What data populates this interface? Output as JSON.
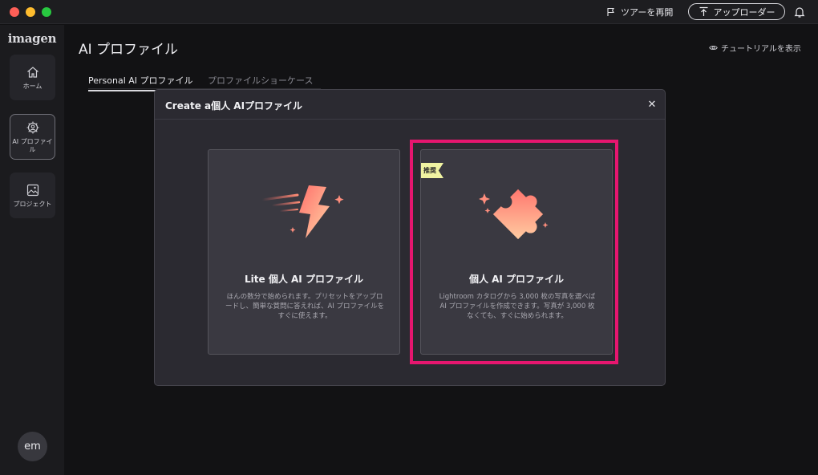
{
  "titlebar": {
    "tour_label": "ツアーを再開",
    "uploader_label": "アップローダー"
  },
  "sidebar": {
    "logo": "imagen",
    "items": [
      {
        "label": "ホーム",
        "icon": "home-icon"
      },
      {
        "label": "AI プロファイル",
        "icon": "ai-profile-icon"
      },
      {
        "label": "プロジェクト",
        "icon": "project-icon"
      }
    ],
    "avatar": "em"
  },
  "main": {
    "title": "AI プロファイル",
    "tutorial_link": "チュートリアルを表示",
    "tabs": [
      {
        "label": "Personal AI プロファイル",
        "active": true
      },
      {
        "label": "プロファイルショーケース",
        "active": false
      }
    ]
  },
  "modal": {
    "title": "Create a個人 AIプロファイル",
    "close": "✕",
    "cards": [
      {
        "title": "Lite 個人 AI プロファイル",
        "description": "ほんの数分で始められます。プリセットをアップロードし、簡単な質問に答えれば、AI プロファイルをすぐに使えます。",
        "icon": "lightning-icon"
      },
      {
        "title": "個人 AI プロファイル",
        "description": "Lightroom カタログから 3,000 枚の写真を選べば AI プロファイルを作成できます。写真が 3,000 枚なくても、すぐに始められます。",
        "icon": "puzzle-icon",
        "badge": "推奨"
      }
    ]
  },
  "colors": {
    "highlight": "#e6166f",
    "accent_gradient_start": "#ff7a6b",
    "accent_gradient_end": "#ffd2a1"
  }
}
